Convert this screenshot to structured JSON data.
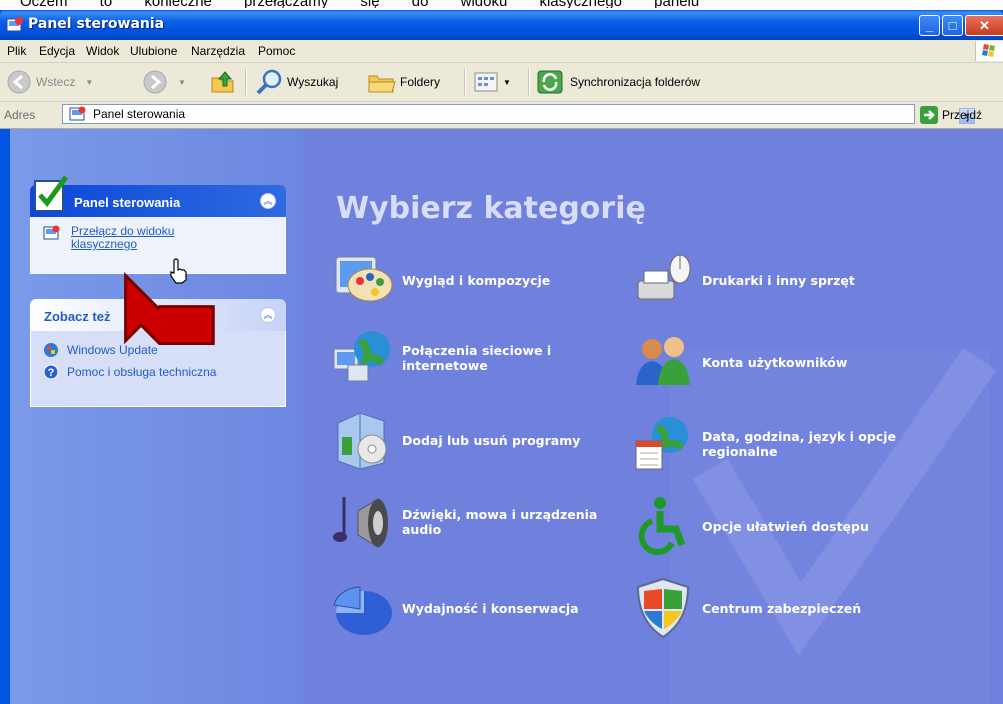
{
  "caption": "Oczem to konieczne przełączamy się do widoku klasycznego panelu",
  "window": {
    "title": "Panel sterowania"
  },
  "menu": [
    "Plik",
    "Edycja",
    "Widok",
    "Ulubione",
    "Narzędzia",
    "Pomoc"
  ],
  "toolbar": {
    "back": "Wstecz",
    "search": "Wyszukaj",
    "folders": "Foldery",
    "sync": "Synchronizacja folderów"
  },
  "address": {
    "label": "Adres",
    "value": "Panel sterowania",
    "go": "Przejdź"
  },
  "sidebar": {
    "control_panel": {
      "title": "Panel sterowania",
      "switch_link_line1": "Przełącz do widoku",
      "switch_link_line2": "klasycznego"
    },
    "see_also": {
      "title": "Zobacz też",
      "items": [
        "Windows Update",
        "Pomoc i obsługa techniczna"
      ]
    }
  },
  "main": {
    "heading": "Wybierz kategorię",
    "categories": [
      "Wygląd i kompozycje",
      "Drukarki i inny sprzęt",
      "Połączenia sieciowe i internetowe",
      "Konta użytkowników",
      "Dodaj lub usuń programy",
      "Data, godzina, język i opcje regionalne",
      "Dźwięki, mowa i urządzenia audio",
      "Opcje ułatwień dostępu",
      "Wydajność i konserwacja",
      "Centrum zabezpieczeń"
    ]
  },
  "colors": {
    "title_blue": "#0055e5",
    "content_bg": "#6f80dd",
    "sidebar_link": "#215dc6",
    "annotation_arrow": "#cc0000"
  }
}
